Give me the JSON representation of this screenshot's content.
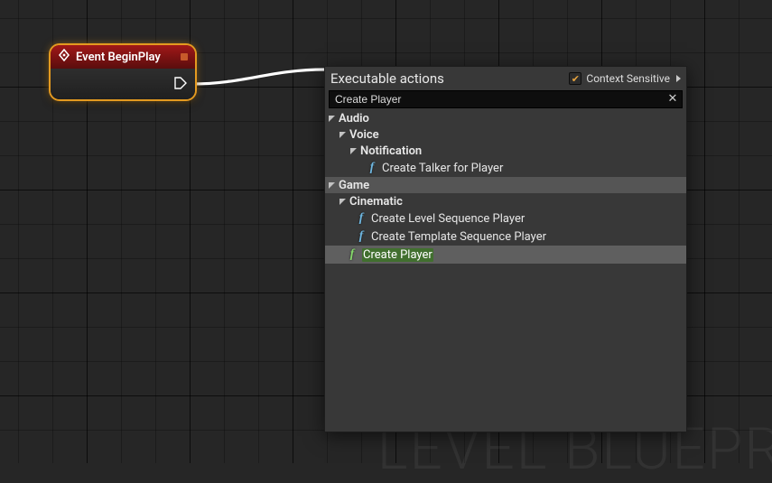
{
  "watermark": "LEVEL BLUEPR",
  "node": {
    "title": "Event BeginPlay"
  },
  "menu": {
    "title": "Executable actions",
    "context_label": "Context Sensitive",
    "context_checked": true,
    "search_value": "Create Player",
    "tree": [
      {
        "label": "Audio",
        "indent": 0,
        "children": [
          {
            "label": "Voice",
            "indent": 1,
            "children": [
              {
                "label": "Notification",
                "indent": 2,
                "children": [
                  {
                    "type": "func",
                    "label": "Create Talker for Player",
                    "indent": 3
                  }
                ]
              }
            ]
          }
        ]
      },
      {
        "label": "Game",
        "indent": 0,
        "highlight_bar": true,
        "children": [
          {
            "label": "Cinematic",
            "indent": 1,
            "children": [
              {
                "type": "func",
                "label": "Create Level Sequence Player",
                "indent": 2
              },
              {
                "type": "func",
                "label": "Create Template Sequence Player",
                "indent": 2
              }
            ]
          },
          {
            "type": "func",
            "label": "Create Player",
            "indent": 1,
            "selected": true,
            "match_highlight": true
          }
        ]
      }
    ]
  },
  "chart_data": null
}
